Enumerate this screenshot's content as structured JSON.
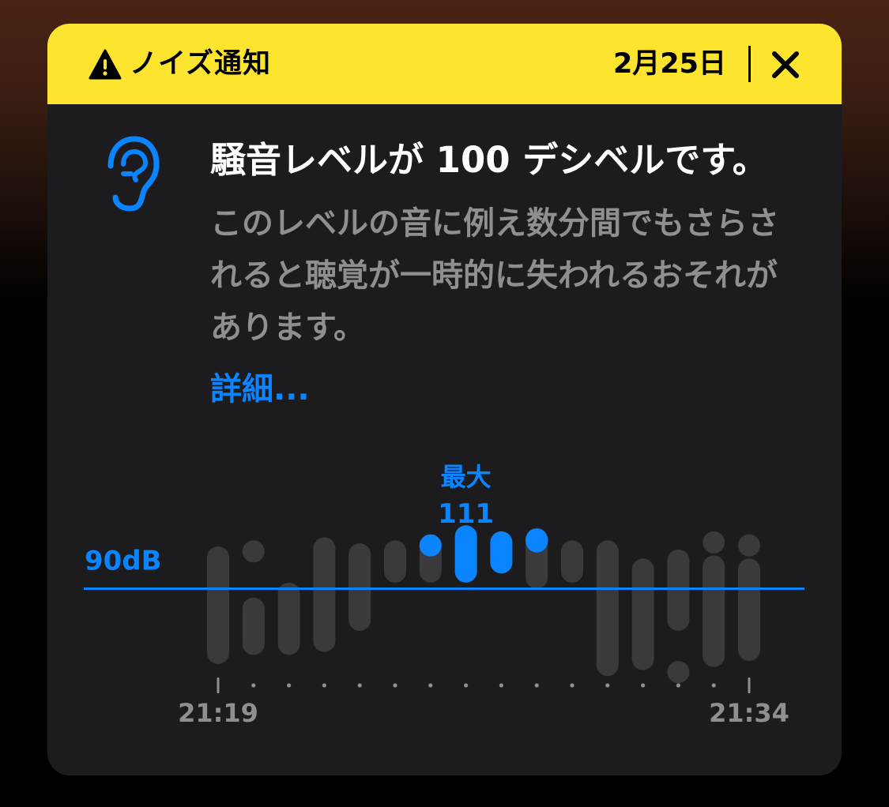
{
  "notification": {
    "title": "ノイズ通知",
    "date": "2月25日",
    "headline": "騒音レベルが 100 デシベルです。",
    "body": "このレベルの音に例え数分間でもさらされると聴覚が一時的に失われるおそれがあります。",
    "more_link": "詳細..."
  },
  "icons": {
    "warning": "warning-triangle-icon",
    "close": "close-x-icon",
    "ear": "ear-icon"
  },
  "colors": {
    "header_bg": "#fde42e",
    "card_bg": "#1c1c1e",
    "accent": "#0a84ff",
    "bar_gray": "#3a3a3c",
    "muted_text": "#8e8e93"
  },
  "chart_data": {
    "type": "bar",
    "threshold": 90,
    "threshold_label": "90dB",
    "max_label": "最大",
    "max_value": 111,
    "ylim": [
      60,
      115
    ],
    "x_start_label": "21:19",
    "x_end_label": "21:34",
    "bars": [
      {
        "segments": [
          [
            65,
            104
          ]
        ],
        "highlight": false
      },
      {
        "segments": [
          [
            68,
            87
          ],
          [
            100,
            106
          ]
        ],
        "highlight": false
      },
      {
        "segments": [
          [
            68,
            92
          ]
        ],
        "highlight": false
      },
      {
        "segments": [
          [
            69,
            107
          ]
        ],
        "highlight": false
      },
      {
        "segments": [
          [
            76,
            105
          ]
        ],
        "highlight": false
      },
      {
        "segments": [
          [
            92,
            106
          ]
        ],
        "highlight": false
      },
      {
        "segments": [
          [
            92,
            108
          ]
        ],
        "highlight": false,
        "overlay": [
          101,
          108
        ]
      },
      {
        "segments": [
          [
            92,
            111
          ]
        ],
        "highlight": true
      },
      {
        "segments": [
          [
            95,
            109
          ]
        ],
        "highlight": true
      },
      {
        "segments": [
          [
            90,
            110
          ]
        ],
        "highlight": false,
        "overlay": [
          102,
          110
        ]
      },
      {
        "segments": [
          [
            92,
            106
          ]
        ],
        "highlight": false
      },
      {
        "segments": [
          [
            61,
            106
          ]
        ],
        "highlight": false
      },
      {
        "segments": [
          [
            63,
            100
          ]
        ],
        "highlight": false
      },
      {
        "segments": [
          [
            76,
            103
          ]
        ],
        "highlight": false,
        "extra": [
          [
            62,
            66
          ]
        ]
      },
      {
        "segments": [
          [
            64,
            101
          ],
          [
            104,
            109
          ]
        ],
        "highlight": false
      },
      {
        "segments": [
          [
            66,
            100
          ],
          [
            104,
            108
          ]
        ],
        "highlight": false
      }
    ]
  }
}
